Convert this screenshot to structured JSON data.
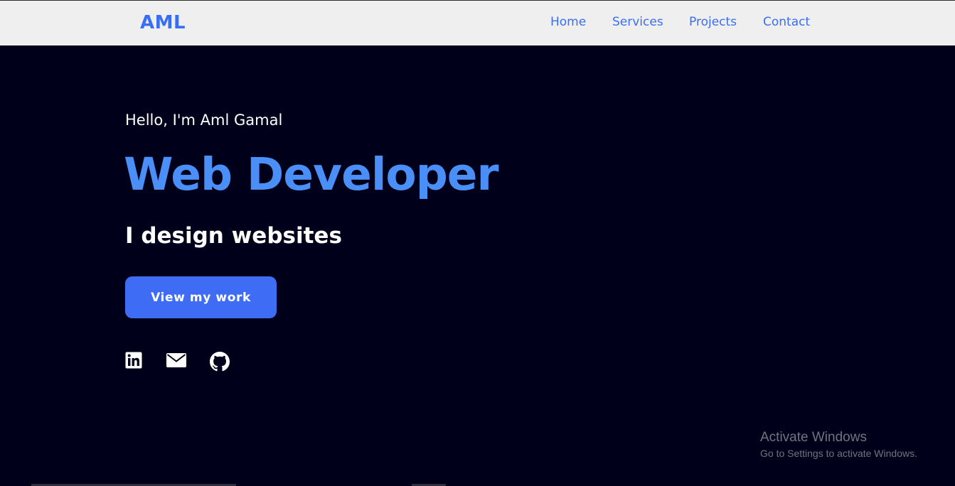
{
  "header": {
    "logo": "AML",
    "nav": [
      {
        "label": "Home"
      },
      {
        "label": "Services"
      },
      {
        "label": "Projects"
      },
      {
        "label": "Contact"
      }
    ]
  },
  "hero": {
    "greeting": "Hello, I'm Aml Gamal",
    "role": "Web Developer",
    "tagline": "I design websites",
    "cta_label": "View my work",
    "social_icons": [
      "linkedin-icon",
      "envelope-icon",
      "github-icon"
    ]
  },
  "watermark": {
    "title": "Activate Windows",
    "subtitle": "Go to Settings to activate Windows."
  },
  "colors": {
    "page_bg": "#00001a",
    "navbar_bg": "#efefef",
    "accent": "#3a6ef2",
    "role_text": "#4a8ff7",
    "button_bg": "#3e6cf4"
  }
}
